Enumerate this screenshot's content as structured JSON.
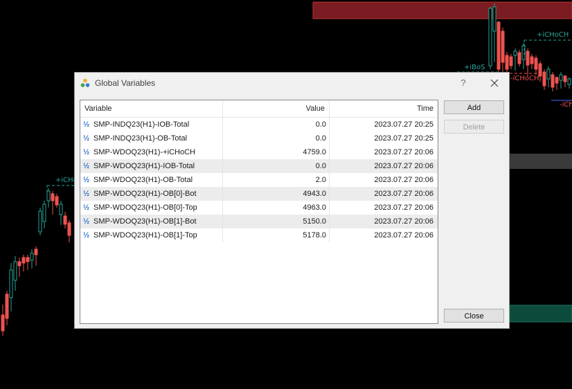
{
  "chart": {
    "labels": {
      "ibos": "+iBoS",
      "ichoch_pos_top": "+iCHoCH",
      "ichoch_neg": "-iCHoCH",
      "ich_neg_right": "-iCh",
      "ichoch_pos_left": "+iCHo"
    },
    "colors": {
      "bull": "#26a69a",
      "bear": "#ef5350",
      "zone_red": "#7a1c22",
      "zone_green": "#0c4a3c",
      "zone_gray": "#3a3a3a"
    }
  },
  "dialog": {
    "title": "Global Variables",
    "help": "?",
    "columns": {
      "variable": "Variable",
      "value": "Value",
      "time": "Time"
    },
    "rows": [
      {
        "variable": "SMP-INDQ23(H1)-IOB-Total",
        "value": "0.0",
        "time": "2023.07.27 20:25"
      },
      {
        "variable": "SMP-INDQ23(H1)-OB-Total",
        "value": "0.0",
        "time": "2023.07.27 20:25"
      },
      {
        "variable": "SMP-WDOQ23(H1)-+iCHoCH",
        "value": "4759.0",
        "time": "2023.07.27 20:06"
      },
      {
        "variable": "SMP-WDOQ23(H1)-IOB-Total",
        "value": "0.0",
        "time": "2023.07.27 20:06"
      },
      {
        "variable": "SMP-WDOQ23(H1)-OB-Total",
        "value": "2.0",
        "time": "2023.07.27 20:06"
      },
      {
        "variable": "SMP-WDOQ23(H1)-OB[0]-Bot",
        "value": "4943.0",
        "time": "2023.07.27 20:06"
      },
      {
        "variable": "SMP-WDOQ23(H1)-OB[0]-Top",
        "value": "4963.0",
        "time": "2023.07.27 20:06"
      },
      {
        "variable": "SMP-WDOQ23(H1)-OB[1]-Bot",
        "value": "5150.0",
        "time": "2023.07.27 20:06"
      },
      {
        "variable": "SMP-WDOQ23(H1)-OB[1]-Top",
        "value": "5178.0",
        "time": "2023.07.27 20:06"
      }
    ],
    "buttons": {
      "add": "Add",
      "delete": "Delete",
      "close": "Close"
    },
    "row_icon": "½"
  }
}
